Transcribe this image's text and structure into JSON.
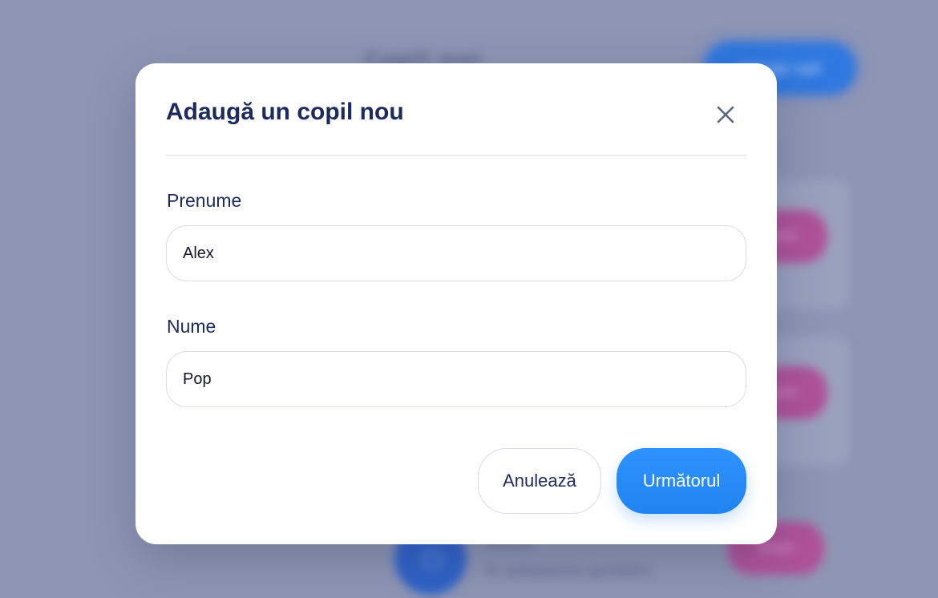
{
  "background": {
    "page_title": "Copiii mei",
    "add_button_label": "Adaugă copil",
    "card_action_label": "Detalii",
    "bottom_item_name": "Andrei",
    "bottom_item_status": "În așteptarea aprobării"
  },
  "modal": {
    "title": "Adaugă un copil nou",
    "close_icon": "close-icon",
    "fields": [
      {
        "label": "Prenume",
        "value": "Alex"
      },
      {
        "label": "Nume",
        "value": "Pop"
      }
    ],
    "cancel_label": "Anulează",
    "next_label": "Următorul"
  },
  "colors": {
    "overlay": "#8f96b4",
    "title": "#1c2a5e",
    "primary": "#1f84f0",
    "accent_pink": "#b0529a"
  }
}
